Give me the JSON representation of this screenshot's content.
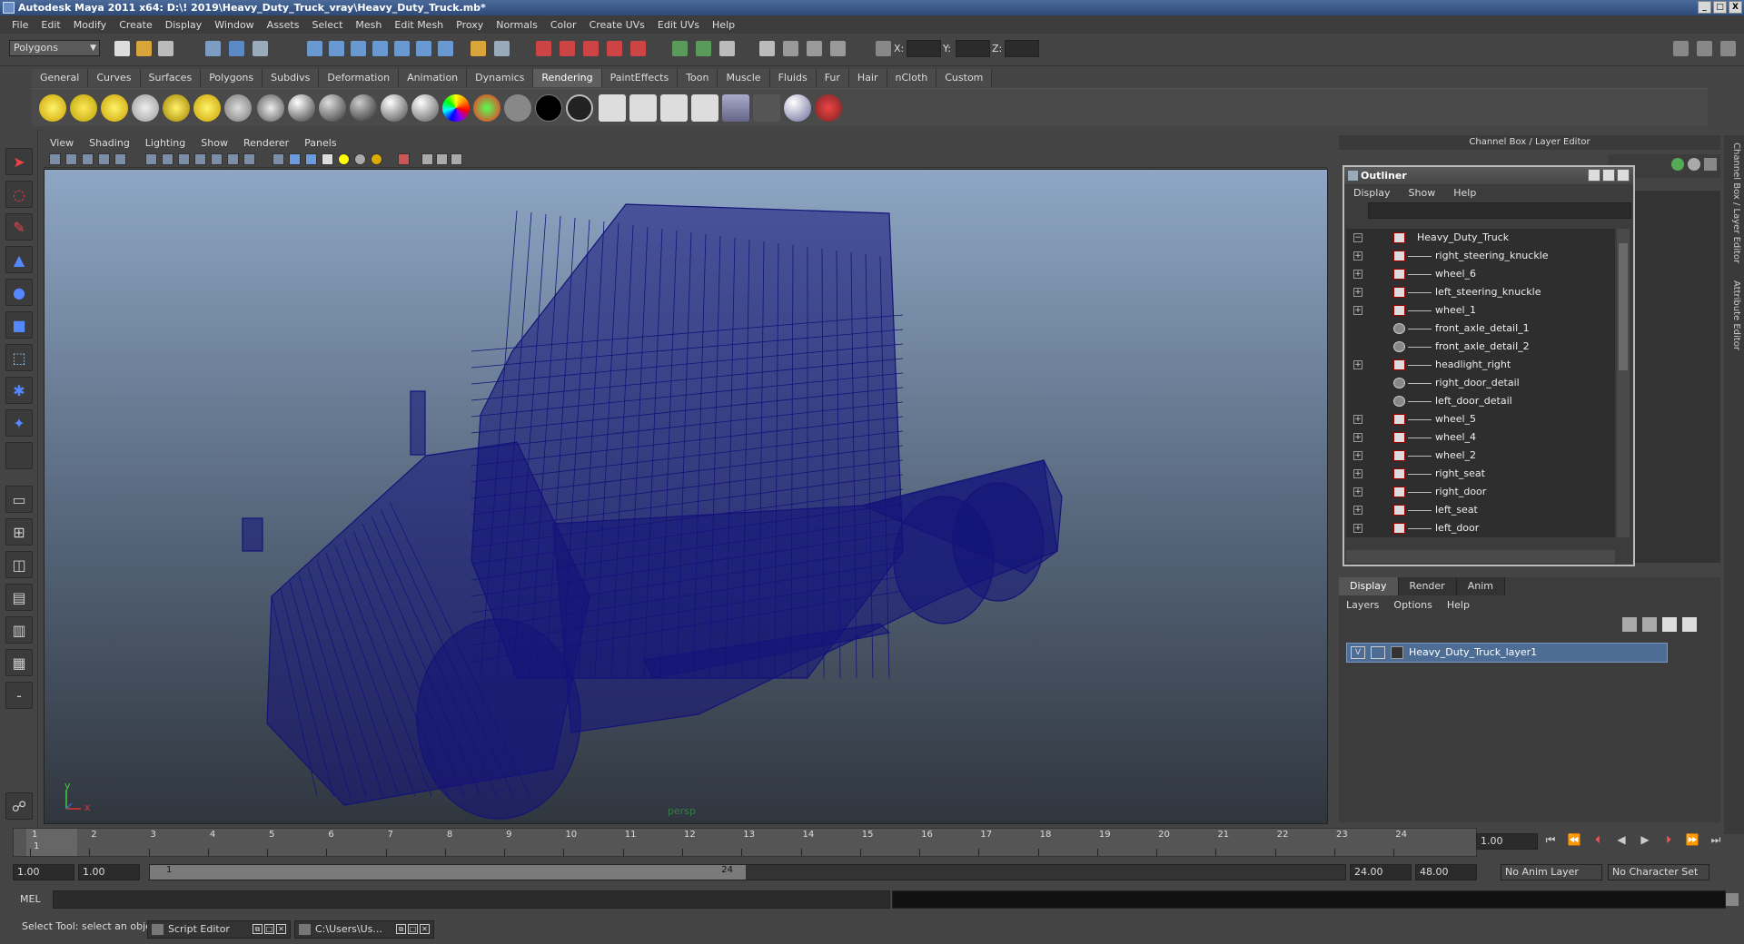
{
  "window": {
    "title": "Autodesk Maya 2011 x64: D:\\! 2019\\Heavy_Duty_Truck_vray\\Heavy_Duty_Truck.mb*",
    "buttons": [
      "_",
      "□",
      "X"
    ]
  },
  "menu": [
    "File",
    "Edit",
    "Modify",
    "Create",
    "Display",
    "Window",
    "Assets",
    "Select",
    "Mesh",
    "Edit Mesh",
    "Proxy",
    "Normals",
    "Color",
    "Create UVs",
    "Edit UVs",
    "Help"
  ],
  "status": {
    "mode": "Polygons",
    "x_label": "X:",
    "y_label": "Y:",
    "z_label": "Z:"
  },
  "shelf": {
    "tabs": [
      "General",
      "Curves",
      "Surfaces",
      "Polygons",
      "Subdivs",
      "Deformation",
      "Animation",
      "Dynamics",
      "Rendering",
      "PaintEffects",
      "Toon",
      "Muscle",
      "Fluids",
      "Fur",
      "Hair",
      "nCloth",
      "Custom"
    ],
    "active": "Rendering"
  },
  "viewport": {
    "menu": [
      "View",
      "Shading",
      "Lighting",
      "Show",
      "Renderer",
      "Panels"
    ],
    "camera": "persp",
    "axis_y": "y",
    "axis_x": "x",
    "wire_color": "#13137a"
  },
  "channel_box": {
    "title": "Channel Box / Layer Editor"
  },
  "outliner": {
    "title": "Outliner",
    "menu": [
      "Display",
      "Show",
      "Help"
    ],
    "items": [
      {
        "label": "Heavy_Duty_Truck",
        "expand": "−",
        "type": "mesh",
        "root": true
      },
      {
        "label": "right_steering_knuckle",
        "expand": "+",
        "type": "mesh"
      },
      {
        "label": "wheel_6",
        "expand": "+",
        "type": "mesh"
      },
      {
        "label": "left_steering_knuckle",
        "expand": "+",
        "type": "mesh"
      },
      {
        "label": "wheel_1",
        "expand": "+",
        "type": "mesh"
      },
      {
        "label": "front_axle_detail_1",
        "expand": "",
        "type": "group"
      },
      {
        "label": "front_axle_detail_2",
        "expand": "",
        "type": "group"
      },
      {
        "label": "headlight_right",
        "expand": "+",
        "type": "mesh"
      },
      {
        "label": "right_door_detail",
        "expand": "",
        "type": "group"
      },
      {
        "label": "left_door_detail",
        "expand": "",
        "type": "group"
      },
      {
        "label": "wheel_5",
        "expand": "+",
        "type": "mesh"
      },
      {
        "label": "wheel_4",
        "expand": "+",
        "type": "mesh"
      },
      {
        "label": "wheel_2",
        "expand": "+",
        "type": "mesh"
      },
      {
        "label": "right_seat",
        "expand": "+",
        "type": "mesh"
      },
      {
        "label": "right_door",
        "expand": "+",
        "type": "mesh"
      },
      {
        "label": "left_seat",
        "expand": "+",
        "type": "mesh"
      },
      {
        "label": "left_door",
        "expand": "+",
        "type": "mesh"
      }
    ]
  },
  "layers": {
    "tabs": [
      "Display",
      "Render",
      "Anim"
    ],
    "active": "Display",
    "menu": [
      "Layers",
      "Options",
      "Help"
    ],
    "row": {
      "visible": "V",
      "name": "Heavy_Duty_Truck_layer1"
    }
  },
  "side_tabs": [
    "Channel Box / Layer Editor",
    "Attribute Editor"
  ],
  "timeline": {
    "ticks": [
      "1",
      "2",
      "3",
      "4",
      "5",
      "6",
      "7",
      "8",
      "9",
      "10",
      "11",
      "12",
      "13",
      "14",
      "15",
      "16",
      "17",
      "18",
      "19",
      "20",
      "21",
      "22",
      "23",
      "24"
    ],
    "current_marker": "1",
    "current": "1.00"
  },
  "range": {
    "start": "1.00",
    "start2": "1.00",
    "slider_start": "1",
    "slider_end": "24",
    "end": "24.00",
    "end2": "48.00",
    "anim_layer": "No Anim Layer",
    "char_set": "No Character Set"
  },
  "command": {
    "label": "MEL"
  },
  "help": {
    "text": "Select Tool: select an object"
  },
  "tasks": [
    "Script Editor",
    "C:\\Users\\Us..."
  ]
}
